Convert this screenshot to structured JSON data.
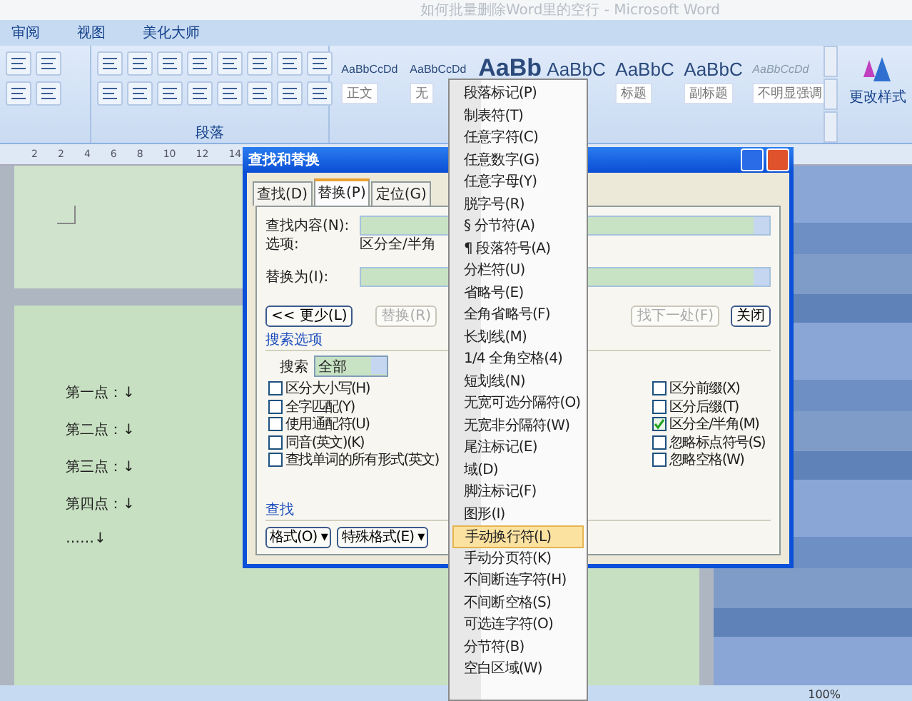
{
  "window": {
    "title": "如何批量删除Word里的空行 - Microsoft Word"
  },
  "ribbon_tabs": [
    {
      "label": "审阅",
      "selected": false
    },
    {
      "label": "视图",
      "selected": false
    },
    {
      "label": "美化大师",
      "selected": false
    }
  ],
  "ribbon": {
    "paragraph_group": "段落",
    "styles": [
      {
        "preview": "AaBbCcDd",
        "label": "正文",
        "kind": "small"
      },
      {
        "preview": "AaBbCcDd",
        "label": "无",
        "kind": "small"
      },
      {
        "preview": "AaBb",
        "kind": "big"
      },
      {
        "preview": "AaBbC",
        "kind": "medium"
      },
      {
        "preview": "AaBbC",
        "label": "标题",
        "kind": "medium"
      },
      {
        "preview": "AaBbC",
        "label": "副标题",
        "kind": "medium"
      },
      {
        "preview": "AaBbCcDd",
        "label": "不明显强调",
        "kind": "italic"
      }
    ],
    "change_styles": "更改样式"
  },
  "ruler": [
    "2",
    "2",
    "4",
    "6",
    "8",
    "10",
    "12",
    "14"
  ],
  "document": {
    "lines": [
      "第一点：↓",
      "第二点：↓",
      "第三点：↓",
      "第四点：↓",
      "……↓"
    ]
  },
  "dialog": {
    "title": "查找和替换",
    "tabs": [
      {
        "label": "查找(D)",
        "selected": false
      },
      {
        "label": "替换(P)",
        "selected": true
      },
      {
        "label": "定位(G)",
        "selected": false
      }
    ],
    "find_label": "查找内容(N):",
    "options_label": "选项:",
    "options_value": "区分全/半角",
    "replace_label": "替换为(I):",
    "buttons": [
      {
        "label": "<< 更少(L)",
        "disabled": false
      },
      {
        "label": "替换(R)",
        "disabled": true
      },
      {
        "label": "找下一处(F)",
        "disabled": true
      },
      {
        "label": "关闭",
        "disabled": false
      }
    ],
    "search_options_title": "搜索选项",
    "search_label": "搜索",
    "search_value": "全部",
    "left_options": [
      {
        "label": "区分大小写(H)",
        "checked": false
      },
      {
        "label": "全字匹配(Y)",
        "checked": false
      },
      {
        "label": "使用通配符(U)",
        "checked": false
      },
      {
        "label": "同音(英文)(K)",
        "checked": false
      },
      {
        "label": "查找单词的所有形式(英文)",
        "checked": false
      }
    ],
    "right_options": [
      {
        "label": "区分前缀(X)",
        "checked": false
      },
      {
        "label": "区分后缀(T)",
        "checked": false
      },
      {
        "label": "区分全/半角(M)",
        "checked": true
      },
      {
        "label": "忽略标点符号(S)",
        "checked": false
      },
      {
        "label": "忽略空格(W)",
        "checked": false
      }
    ],
    "find_section": "查找",
    "bottom_buttons": [
      "格式(O) ▾",
      "特殊格式(E) ▾"
    ]
  },
  "special_menu": {
    "items": [
      {
        "label": "段落标记(P)",
        "selected": false
      },
      {
        "label": "制表符(T)",
        "selected": false
      },
      {
        "label": "任意字符(C)",
        "selected": false
      },
      {
        "label": "任意数字(G)",
        "selected": false
      },
      {
        "label": "任意字母(Y)",
        "selected": false
      },
      {
        "label": "脱字号(R)",
        "selected": false
      },
      {
        "label": "§ 分节符(A)",
        "selected": false
      },
      {
        "label": "¶ 段落符号(A)",
        "selected": false
      },
      {
        "label": "分栏符(U)",
        "selected": false
      },
      {
        "label": "省略号(E)",
        "selected": false
      },
      {
        "label": "全角省略号(F)",
        "selected": false
      },
      {
        "label": "长划线(M)",
        "selected": false
      },
      {
        "label": "1/4 全角空格(4)",
        "selected": false
      },
      {
        "label": "短划线(N)",
        "selected": false
      },
      {
        "label": "无宽可选分隔符(O)",
        "selected": false
      },
      {
        "label": "无宽非分隔符(W)",
        "selected": false
      },
      {
        "label": "尾注标记(E)",
        "selected": false
      },
      {
        "label": "域(D)",
        "selected": false
      },
      {
        "label": "脚注标记(F)",
        "selected": false
      },
      {
        "label": "图形(I)",
        "selected": false
      },
      {
        "label": "手动换行符(L)",
        "selected": true
      },
      {
        "label": "手动分页符(K)",
        "selected": false
      },
      {
        "label": "不间断连字符(H)",
        "selected": false
      },
      {
        "label": "不间断空格(S)",
        "selected": false
      },
      {
        "label": "可选连字符(O)",
        "selected": false
      },
      {
        "label": "分节符(B)",
        "selected": false
      },
      {
        "label": "空白区域(W)",
        "selected": false
      }
    ]
  },
  "status_bar": {
    "zoom": "100%"
  }
}
